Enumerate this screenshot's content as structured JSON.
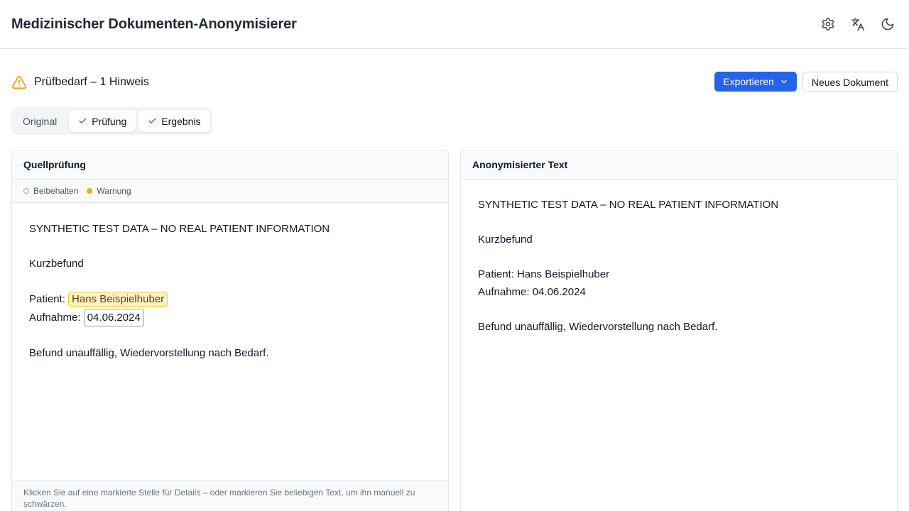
{
  "app": {
    "title": "Medizinischer Dokumenten-Anonymisierer"
  },
  "header": {
    "icons": [
      "gear-icon",
      "translate-icon",
      "moon-icon"
    ]
  },
  "review": {
    "text": "Prüfbedarf – 1 Hinweis"
  },
  "actions": {
    "export_label": "Exportieren",
    "new_document_label": "Neues Dokument"
  },
  "tabs": [
    {
      "label": "Original",
      "checked": false
    },
    {
      "label": "Prüfung",
      "checked": true
    },
    {
      "label": "Ergebnis",
      "checked": true
    }
  ],
  "source_panel": {
    "title": "Quellprüfung",
    "legend": {
      "keep": "Beibehalten",
      "warning": "Warnung"
    },
    "lines": {
      "header": "SYNTHETIC TEST DATA – NO REAL PATIENT INFORMATION",
      "subtitle": "Kurzbefund",
      "patient_label": "Patient:",
      "patient_value": "Hans Beispielhuber",
      "admission_label": "Aufnahme:",
      "admission_value": "04.06.2024",
      "finding": "Befund unauffällig, Wiedervorstellung nach Bedarf."
    },
    "footer": "Klicken Sie auf eine markierte Stelle für Details – oder markieren Sie beliebigen Text, um ihn manuell zu schwärzen."
  },
  "result_panel": {
    "title": "Anonymisierter Text",
    "lines": {
      "header": "SYNTHETIC TEST DATA – NO REAL PATIENT INFORMATION",
      "subtitle": "Kurzbefund",
      "patient": "Patient: Hans Beispielhuber",
      "admission": "Aufnahme: 04.06.2024",
      "finding": "Befund unauffällig, Wiedervorstellung nach Bedarf."
    }
  },
  "colors": {
    "accent": "#2563eb",
    "warning": "#f59e0b",
    "highlight_warning": "#fef3c7"
  }
}
